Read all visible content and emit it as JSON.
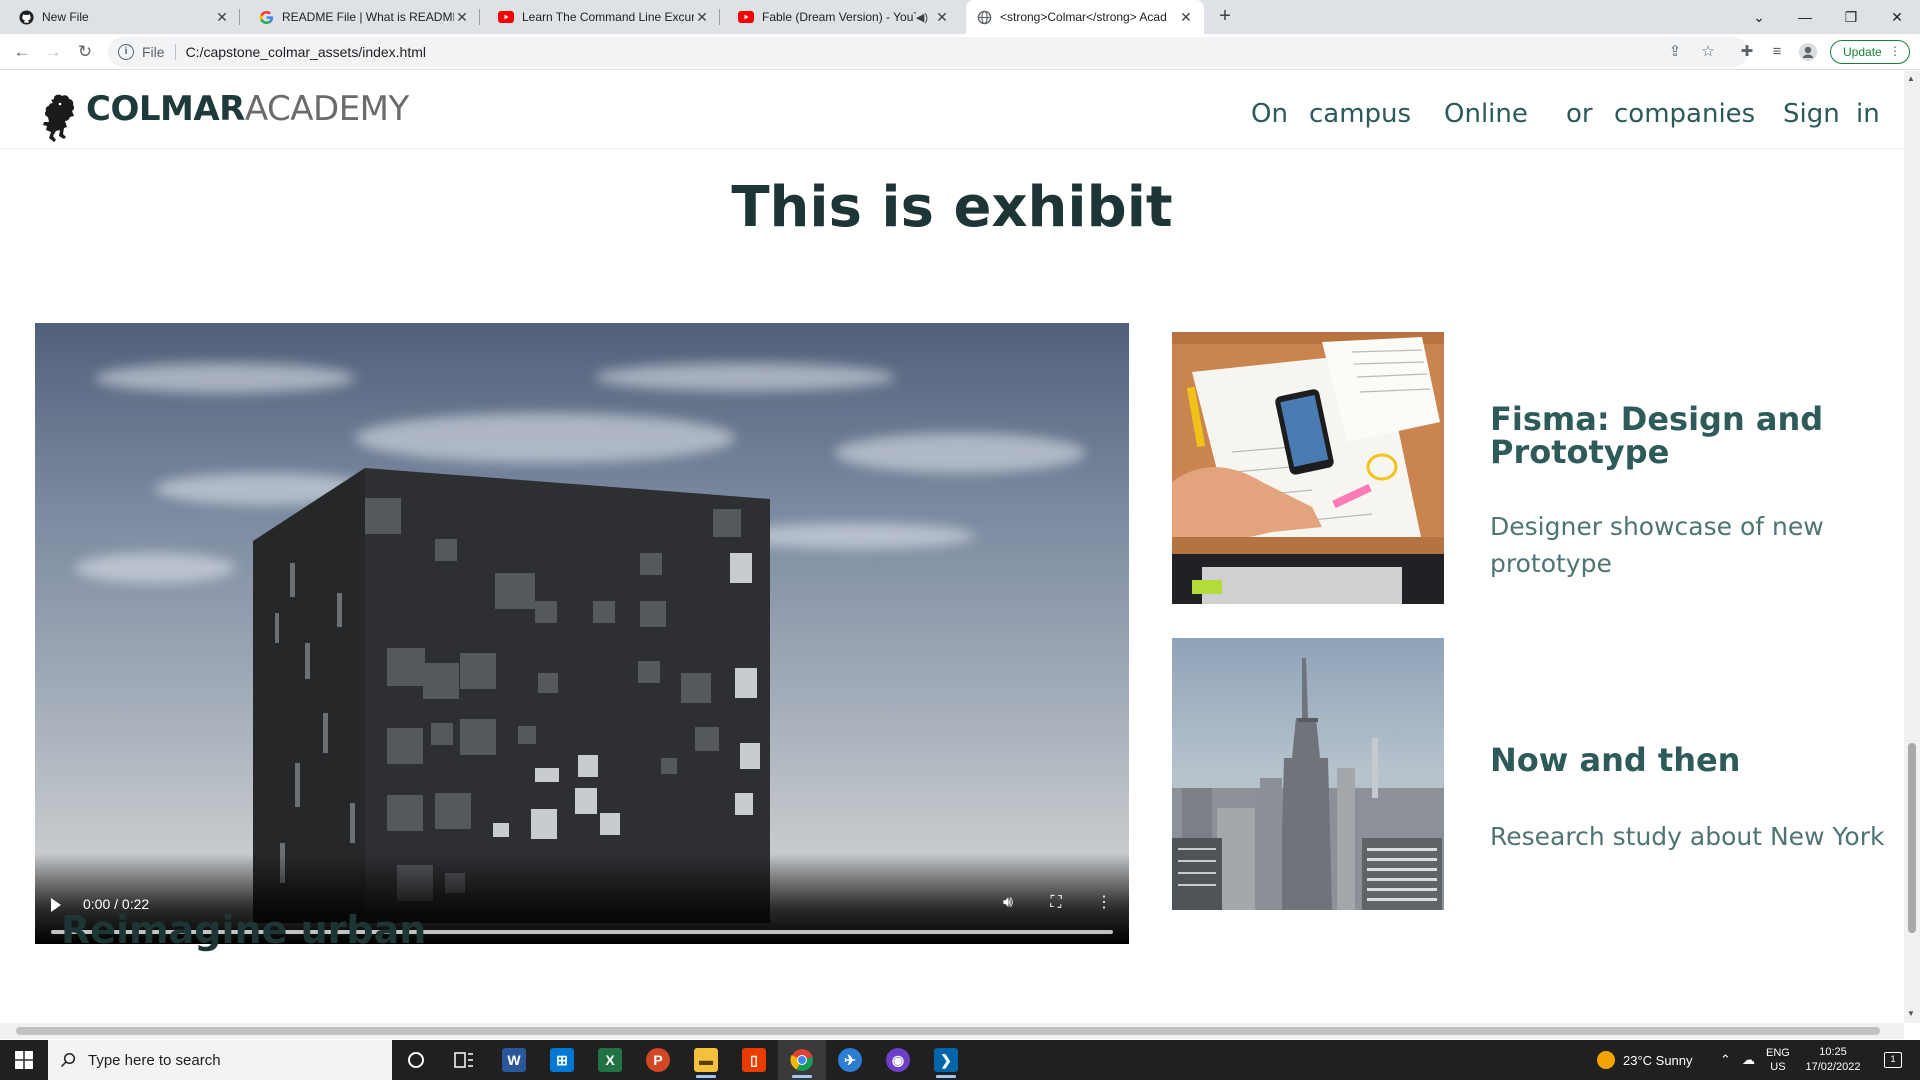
{
  "browser": {
    "tabs": [
      {
        "title": "New File",
        "icon": "github-icon"
      },
      {
        "title": "README File | What is README &",
        "icon": "google-icon"
      },
      {
        "title": "Learn The Command Line Excursi",
        "icon": "youtube-icon"
      },
      {
        "title": "Fable (Dream Version) - YouTu",
        "icon": "youtube-icon"
      },
      {
        "title": "<strong>Colmar</strong> Acad",
        "icon": "globe-icon"
      }
    ],
    "scheme_label": "File",
    "url": "C:/capstone_colmar_assets/index.html",
    "update_label": "Update"
  },
  "site": {
    "brand_bold": "COLMAR",
    "brand_light": "ACADEMY",
    "nav": [
      {
        "label": "On campus"
      },
      {
        "label": "Online"
      },
      {
        "label": "or companies"
      },
      {
        "label": "Sign in"
      }
    ],
    "nav_words": [
      "On",
      "campus",
      "Online",
      "or",
      "companies",
      "Sign",
      "in"
    ]
  },
  "main": {
    "title": "This is exhibit",
    "video": {
      "time": "0:00 / 0:22"
    },
    "cards": [
      {
        "title": "Fisma: Design and Prototype",
        "description": "Designer showcase of new prototype",
        "image": "desk-workspace-photo"
      },
      {
        "title": "Now and then",
        "description": "Research study about New York",
        "image": "new-york-skyline-photo"
      }
    ],
    "next_section_title": "Reimagine urban"
  },
  "taskbar": {
    "search_placeholder": "Type here to search",
    "weather": "23°C  Sunny",
    "lang_top": "ENG",
    "lang_bottom": "US",
    "time": "10:25",
    "date": "17/02/2022",
    "notification_count": "1"
  },
  "colors": {
    "heading": "#1d3535",
    "accent": "#2e5a5a",
    "nav": "#2c5a5a",
    "update_green": "#188038"
  }
}
